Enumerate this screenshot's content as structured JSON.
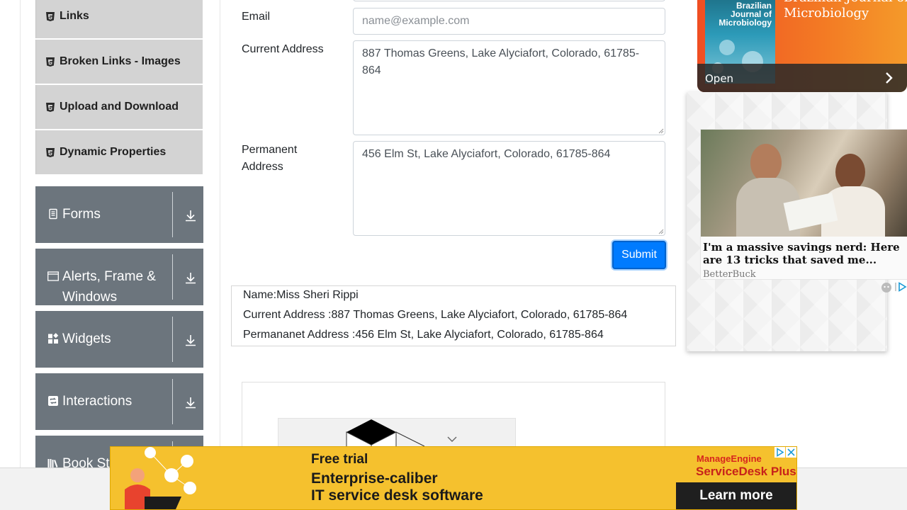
{
  "sidebar": {
    "sub_items": [
      {
        "label": "Links"
      },
      {
        "label": "Broken Links - Images"
      },
      {
        "label": "Upload and Download"
      },
      {
        "label": "Dynamic Properties"
      }
    ],
    "groups": [
      {
        "label": "Forms",
        "icon": "document-icon"
      },
      {
        "label": "Alerts, Frame & Windows",
        "icon": "window-icon"
      },
      {
        "label": "Widgets",
        "icon": "widgets-icon"
      },
      {
        "label": "Interactions",
        "icon": "interactions-icon"
      },
      {
        "label": "Book Store Application",
        "icon": "books-icon"
      }
    ]
  },
  "form": {
    "email_label": "Email",
    "email_placeholder": "name@example.com",
    "current_address_label": "Current Address",
    "current_address_value": "887 Thomas Greens, Lake Alyciafort, Colorado, 61785-864",
    "permanent_address_label": "Permanent Address",
    "permanent_address_value": "456 Elm St, Lake Alyciafort, Colorado, 61785-864",
    "submit_label": "Submit"
  },
  "output": {
    "name": "Name:Miss Sheri Rippi",
    "current_address": "Current Address :887 Thomas Greens, Lake Alyciafort, Colorado, 61785-864",
    "permanent_address": "Permananet Address :456 Elm St, Lake Alyciafort, Colorado, 61785-864"
  },
  "ads": {
    "journal_title": "Brazilian Journal of Microbiology",
    "journal_heading": "Brazilian Journal of Microbiology",
    "open_label": "Open",
    "article_title": "I'm a massive savings nerd: Here are 13 tricks that saved me...",
    "article_source": "BetterBuck",
    "banner_line1": "Free trial",
    "banner_line2": "Enterprise-caliber",
    "banner_line3": "IT service desk software",
    "banner_brand": "ManageEngine",
    "banner_product": "ServiceDesk Plus",
    "banner_cta": "Learn more"
  },
  "colors": {
    "primary": "#007bff",
    "group_bg": "#6c757d",
    "sub_item_bg": "#d3d3d3",
    "banner_bg": "#f5c12e"
  }
}
